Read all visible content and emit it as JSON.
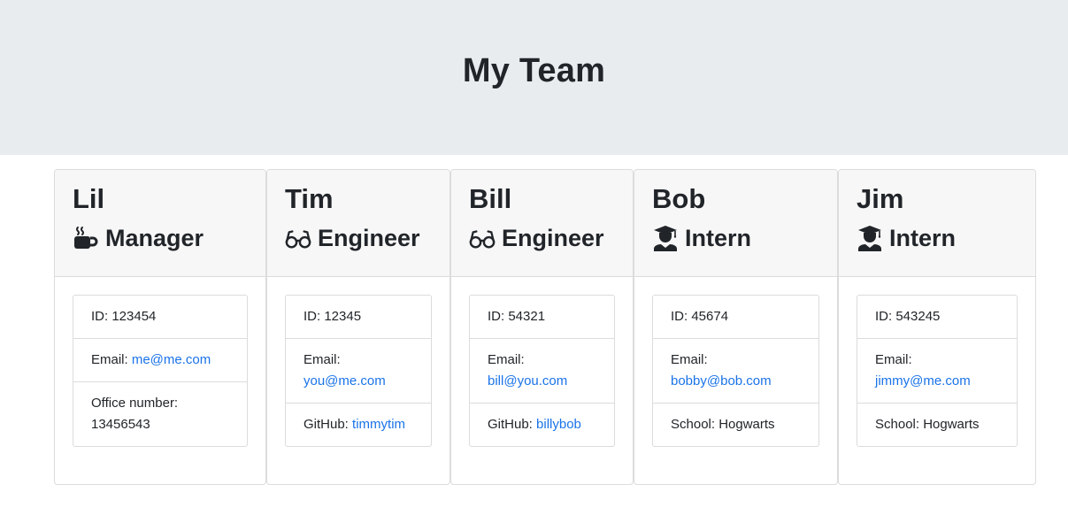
{
  "header": {
    "title": "My Team"
  },
  "icons": {
    "manager": "coffee-cup",
    "engineer": "glasses",
    "intern": "graduate"
  },
  "colors": {
    "link": "#1a73e8",
    "jumbotron_bg": "#e9ecef"
  },
  "team": [
    {
      "name": "Lil",
      "role": "Manager",
      "id_label": "ID: ",
      "id": "123454",
      "email_label": "Email: ",
      "email": "me@me.com",
      "extra_label": "Office number: ",
      "extra_value": "13456543"
    },
    {
      "name": "Tim",
      "role": "Engineer",
      "id_label": "ID: ",
      "id": "12345",
      "email_label": "Email: ",
      "email": "you@me.com",
      "extra_label": "GitHub: ",
      "extra_value": "timmytim"
    },
    {
      "name": "Bill",
      "role": "Engineer",
      "id_label": "ID: ",
      "id": "54321",
      "email_label": "Email: ",
      "email": "bill@you.com",
      "extra_label": "GitHub: ",
      "extra_value": "billybob"
    },
    {
      "name": "Bob",
      "role": "Intern",
      "id_label": "ID: ",
      "id": "45674",
      "email_label": "Email: ",
      "email": "bobby@bob.com",
      "extra_label": "School: ",
      "extra_value": "Hogwarts"
    },
    {
      "name": "Jim",
      "role": "Intern",
      "id_label": "ID: ",
      "id": "543245",
      "email_label": "Email: ",
      "email": "jimmy@me.com",
      "extra_label": "School: ",
      "extra_value": "Hogwarts"
    }
  ]
}
